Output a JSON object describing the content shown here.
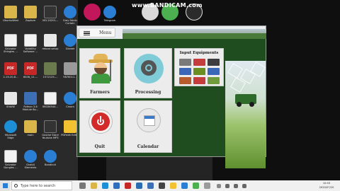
{
  "overlay": {
    "recorder_watermark": "www.BANDICAM.com"
  },
  "desktop": {
    "icons": [
      {
        "label": "UbuntuWest",
        "icon": "folder-icon"
      },
      {
        "label": "Zapture",
        "icon": "folder-icon"
      },
      {
        "label": "VID-20201...",
        "icon": "video-icon"
      },
      {
        "label": "Grey Fabric Curtain",
        "icon": "app-icon"
      },
      {
        "label": "Telegram",
        "icon": "telegram-icon"
      },
      {
        "label": "Salvador Shingles ...",
        "icon": "document-icon"
      },
      {
        "label": "Volatility Software ...",
        "icon": "document-icon"
      },
      {
        "label": "reboot setup",
        "icon": "document-icon"
      },
      {
        "label": "Ubuntu...",
        "icon": "image-icon"
      },
      {
        "label": "Gionee",
        "icon": "app-icon"
      },
      {
        "label": "2-19-20-8...",
        "icon": "pdf-icon"
      },
      {
        "label": "6008_12-...",
        "icon": "pdf-icon"
      },
      {
        "label": "1572125-...",
        "icon": "image-icon"
      },
      {
        "label": "9876011...",
        "icon": "image-icon"
      },
      {
        "label": "SHARE",
        "icon": "share-icon"
      },
      {
        "label": "Python 3.6 Module Bo...",
        "icon": "python-icon"
      },
      {
        "label": "66336544...",
        "icon": "document-icon"
      },
      {
        "label": "Cmom",
        "icon": "app-icon"
      },
      {
        "label": "Microsoft Edge",
        "icon": "edge-icon"
      },
      {
        "label": "main",
        "icon": "folder-icon"
      },
      {
        "label": "Gnome Store Youtube MP3 ...",
        "icon": "app-icon"
      },
      {
        "label": "PDFedit Editor",
        "icon": "pdf-editor-icon"
      },
      {
        "label": "Salvador Dongles ...",
        "icon": "document-icon"
      },
      {
        "label": "Gnab4 Elements",
        "icon": "app-icon"
      },
      {
        "label": "Bandicut",
        "icon": "app-icon"
      }
    ]
  },
  "app": {
    "menu_label": "Menu",
    "tiles": {
      "farmers": "Farmers",
      "processing": "Processing",
      "input_equipments": "Input Equipments",
      "quit": "Quit",
      "calendar": "Calendar"
    },
    "equipment_colors": [
      "#7a7a7a",
      "#c43c3c",
      "#3d3d3d",
      "#3a67b7",
      "#6b8e23",
      "#3a67b7",
      "#b85c2e",
      "#c43c3c",
      "#6f9b3a"
    ]
  },
  "taskbar": {
    "search_placeholder": "Type here to search",
    "clock_time": "10:03",
    "clock_date": "2020/07/20"
  },
  "colors": {
    "app_green": "#1f4d1f",
    "tile_bg": "#ececec",
    "quit_red": "#d32a2a",
    "desktop_bg": "#0f0f0f"
  }
}
